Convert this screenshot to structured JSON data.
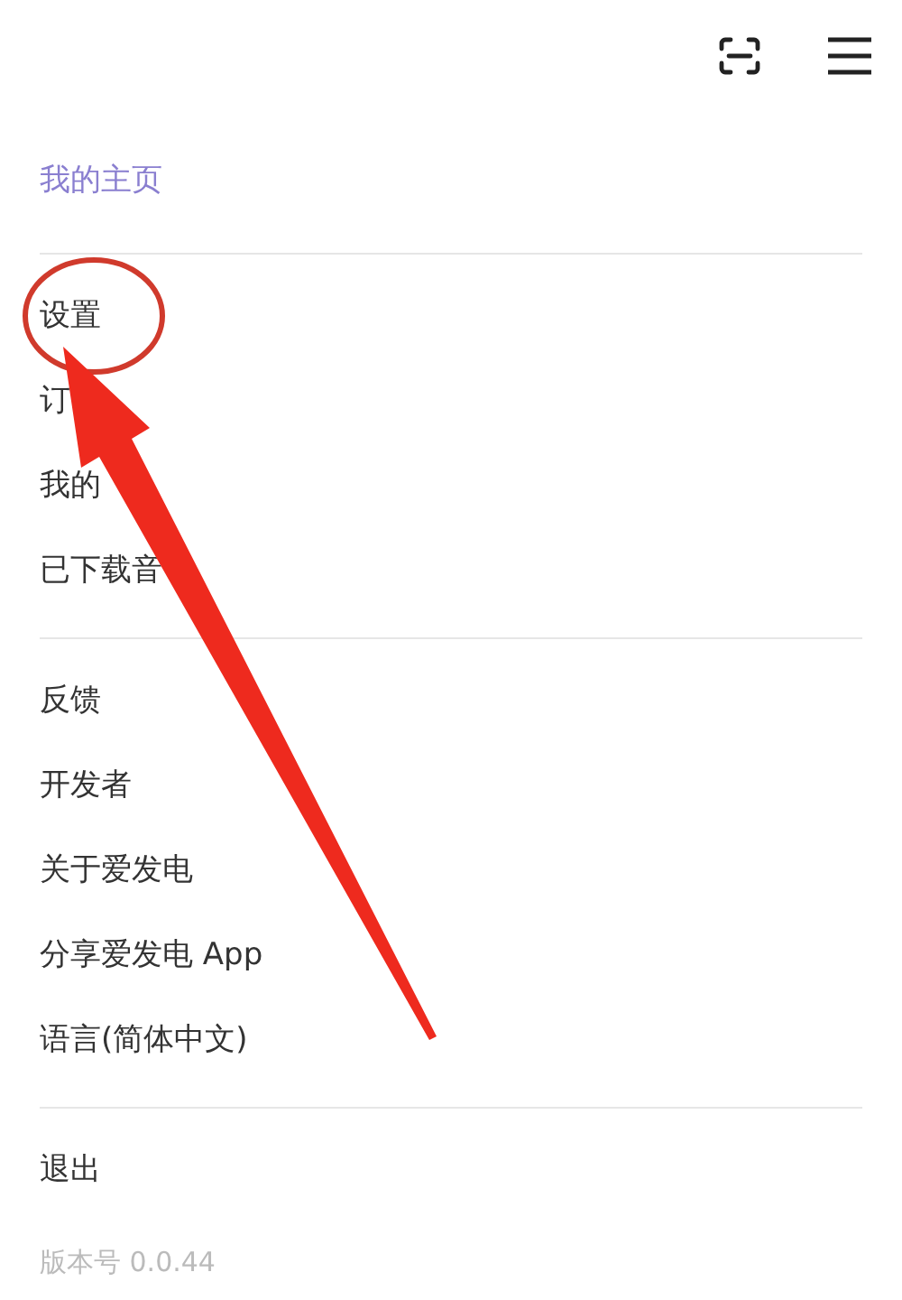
{
  "header": {
    "profile_link": "我的主页"
  },
  "menu_sections": [
    {
      "items": [
        "设置",
        "订",
        "我的",
        "已下载音"
      ]
    },
    {
      "items": [
        "反馈",
        "开发者",
        "关于爱发电",
        "分享爱发电 App",
        "语言(简体中文)"
      ]
    },
    {
      "items": [
        "退出"
      ]
    }
  ],
  "version": "版本号 0.0.44"
}
